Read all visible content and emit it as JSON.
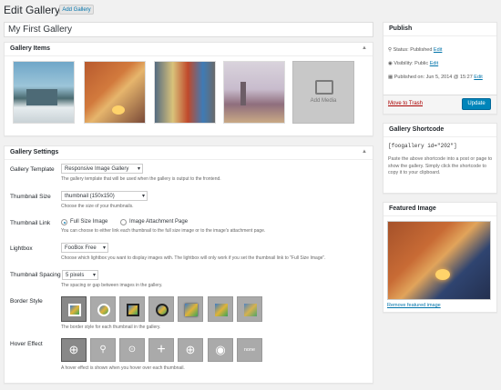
{
  "header": {
    "title": "Edit Gallery",
    "add_label": "Add Gallery"
  },
  "gallery_title_value": "My First Gallery",
  "items_box": {
    "title": "Gallery Items",
    "add_media_label": "Add Media"
  },
  "settings": {
    "title": "Gallery Settings",
    "template": {
      "label": "Gallery Template",
      "value": "Responsive Image Gallery",
      "help": "The gallery template that will be used when the gallery is output to the frontend."
    },
    "thumbnail_size": {
      "label": "Thumbnail Size",
      "value": "thumbnail (150x150)",
      "help": "Choose the size of your thumbnails."
    },
    "thumbnail_link": {
      "label": "Thumbnail Link",
      "option_full": "Full Size Image",
      "option_attachment": "Image Attachment Page",
      "help": "You can choose to either link each thumbnail to the full size image or to the image's attachment page."
    },
    "lightbox": {
      "label": "Lightbox",
      "value": "FooBox Free",
      "help": "Choose which lightbox you want to display images with. The lightbox will only work if you set the thumbnail link to \"Full Size Image\"."
    },
    "spacing": {
      "label": "Thumbnail Spacing",
      "value": "5 pixels",
      "help": "The spacing or gap between images in the gallery."
    },
    "border_style": {
      "label": "Border Style",
      "help": "The border style for each thumbnail in the gallery."
    },
    "hover_effect": {
      "label": "Hover Effect",
      "help": "A hover effect is shown when you hover over each thumbnail.",
      "none_label": "none"
    }
  },
  "publish": {
    "title": "Publish",
    "status_label": "Status:",
    "status_value": "Published",
    "status_edit": "Edit",
    "visibility_label": "Visibility:",
    "visibility_value": "Public",
    "visibility_edit": "Edit",
    "published_label": "Published on:",
    "published_value": "Jun 5, 2014 @ 15:27",
    "published_edit": "Edit",
    "trash": "Move to Trash",
    "update": "Update"
  },
  "shortcode": {
    "title": "Gallery Shortcode",
    "code": "[foogallery id=\"202\"]",
    "help": "Paste the above shortcode into a post or page to show the gallery. Simply click the shortcode to copy it to your clipboard."
  },
  "featured": {
    "title": "Featured Image",
    "remove": "Remove featured image"
  },
  "colors": {
    "accent": "#0073aa",
    "button": "#0085ba",
    "trash": "#aa0000"
  },
  "icons": [
    "caret-up-icon",
    "image-icon",
    "pin-icon",
    "eye-icon",
    "calendar-icon",
    "zoom-in-icon",
    "search-icon",
    "plus-icon",
    "circle-plus-icon"
  ]
}
